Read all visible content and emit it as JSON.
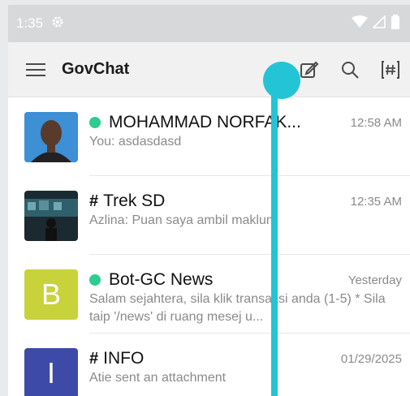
{
  "status_bar": {
    "time": "1:35"
  },
  "app_bar": {
    "title": "GovChat"
  },
  "chats": [
    {
      "name": "MOHAMMAD NORFAK...",
      "online": true,
      "channel": false,
      "time": "12:58 AM",
      "preview": "You: asdasdasd",
      "avatar_type": "photo-portrait"
    },
    {
      "name": "Trek SD",
      "online": false,
      "channel": true,
      "time": "12:35 AM",
      "preview": "Azlina:   Puan saya ambil maklum",
      "avatar_type": "photo-scene"
    },
    {
      "name": "Bot-GC News",
      "online": true,
      "channel": false,
      "time": "Yesterday",
      "preview": "Salam sejahtera, sila klik transaksi anda (1-5) * Sila taip '/news' di ruang mesej u...",
      "avatar_letter": "B",
      "avatar_color": "#c8d23a"
    },
    {
      "name": "INFO",
      "online": false,
      "channel": true,
      "time": "01/29/2025",
      "preview": "Atie sent an attachment",
      "avatar_letter": "I",
      "avatar_color": "#3e4aa8"
    }
  ],
  "colors": {
    "overlay": "#22c4d6",
    "online": "#2ecc8f"
  }
}
